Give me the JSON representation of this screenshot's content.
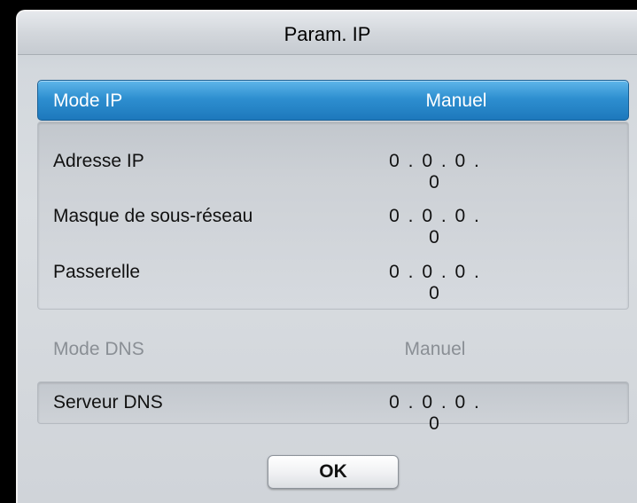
{
  "dialog": {
    "title": "Param. IP"
  },
  "mode_ip": {
    "label": "Mode IP",
    "value": "Manuel"
  },
  "ip_settings": [
    {
      "label": "Adresse IP",
      "value": "0 . 0 . 0 . 0"
    },
    {
      "label": "Masque de sous-réseau",
      "value": "0 . 0 . 0 . 0"
    },
    {
      "label": "Passerelle",
      "value": "0 . 0 . 0 . 0"
    }
  ],
  "mode_dns": {
    "label": "Mode DNS",
    "value": "Manuel"
  },
  "dns_server": {
    "label": "Serveur DNS",
    "value": "0 . 0 . 0 . 0"
  },
  "buttons": {
    "ok_label": "OK"
  },
  "colors": {
    "highlight": "#2e8fd0",
    "dialog_bg": "#d6dadf",
    "disabled_text": "#8a8f95"
  }
}
